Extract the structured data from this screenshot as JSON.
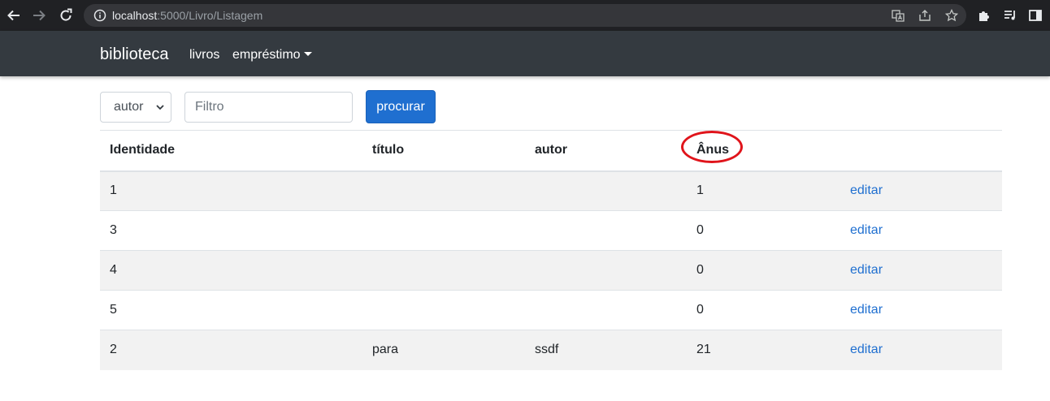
{
  "browser": {
    "url_host": "localhost",
    "url_path": ":5000/Livro/Listagem"
  },
  "navbar": {
    "brand": "biblioteca",
    "links": [
      "livros",
      "empréstimo"
    ]
  },
  "search": {
    "select_value": "autor",
    "filter_placeholder": "Filtro",
    "button_label": "procurar"
  },
  "table": {
    "headers": [
      "Identidade",
      "título",
      "autor",
      "Ânus"
    ],
    "rows": [
      {
        "id": "1",
        "titulo": "",
        "autor": "",
        "anus": "1",
        "action": "editar"
      },
      {
        "id": "3",
        "titulo": "",
        "autor": "",
        "anus": "0",
        "action": "editar"
      },
      {
        "id": "4",
        "titulo": "",
        "autor": "",
        "anus": "0",
        "action": "editar"
      },
      {
        "id": "5",
        "titulo": "",
        "autor": "",
        "anus": "0",
        "action": "editar"
      },
      {
        "id": "2",
        "titulo": "para",
        "autor": "ssdf",
        "anus": "21",
        "action": "editar"
      }
    ]
  },
  "colors": {
    "navbar_bg": "#343a40",
    "primary": "#1f6fd0",
    "highlight_ring": "#e0141b"
  }
}
